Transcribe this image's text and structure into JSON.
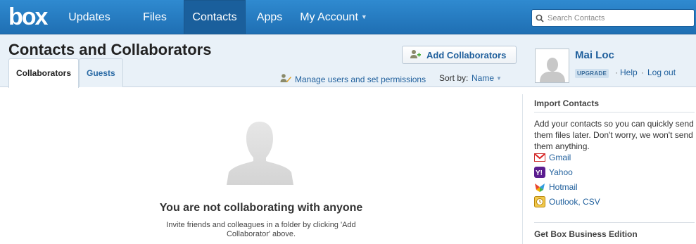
{
  "nav": {
    "logo": "box",
    "items": [
      {
        "label": "Updates",
        "active": false
      },
      {
        "label": "Files",
        "active": false
      },
      {
        "label": "Contacts",
        "active": true
      },
      {
        "label": "Apps",
        "active": false
      },
      {
        "label": "My Account",
        "active": false,
        "dropdown": true
      }
    ],
    "search_placeholder": "Search Contacts"
  },
  "header": {
    "title": "Contacts and Collaborators",
    "tabs": [
      {
        "label": "Collaborators",
        "active": true
      },
      {
        "label": "Guests",
        "active": false
      }
    ],
    "add_button_label": "Add Collaborators",
    "manage_link": "Manage users and set permissions",
    "sort_label": "Sort by:",
    "sort_value": "Name"
  },
  "user": {
    "name": "Mai Loc",
    "badge": "UPGRADE",
    "help": "Help",
    "logout": "Log out"
  },
  "main": {
    "empty_title": "You are not collaborating with anyone",
    "empty_desc": "Invite friends and colleagues in a folder by clicking 'Add Collaborator' above."
  },
  "sidebar": {
    "import_heading": "Import Contacts",
    "import_desc": "Add your contacts so you can quickly send them files later. Don't worry, we won't send them anything.",
    "providers": [
      {
        "label": "Gmail",
        "icon": "gmail-icon"
      },
      {
        "label": "Yahoo",
        "icon": "yahoo-icon"
      },
      {
        "label": "Hotmail",
        "icon": "hotmail-icon"
      },
      {
        "label": "Outlook, CSV",
        "icon": "outlook-icon"
      }
    ],
    "business_heading": "Get Box Business Edition"
  },
  "colors": {
    "nav_blue": "#2f8ad0",
    "nav_active": "#1a5f9c",
    "link": "#1f5f9c",
    "header_bg": "#e9f1f8"
  }
}
